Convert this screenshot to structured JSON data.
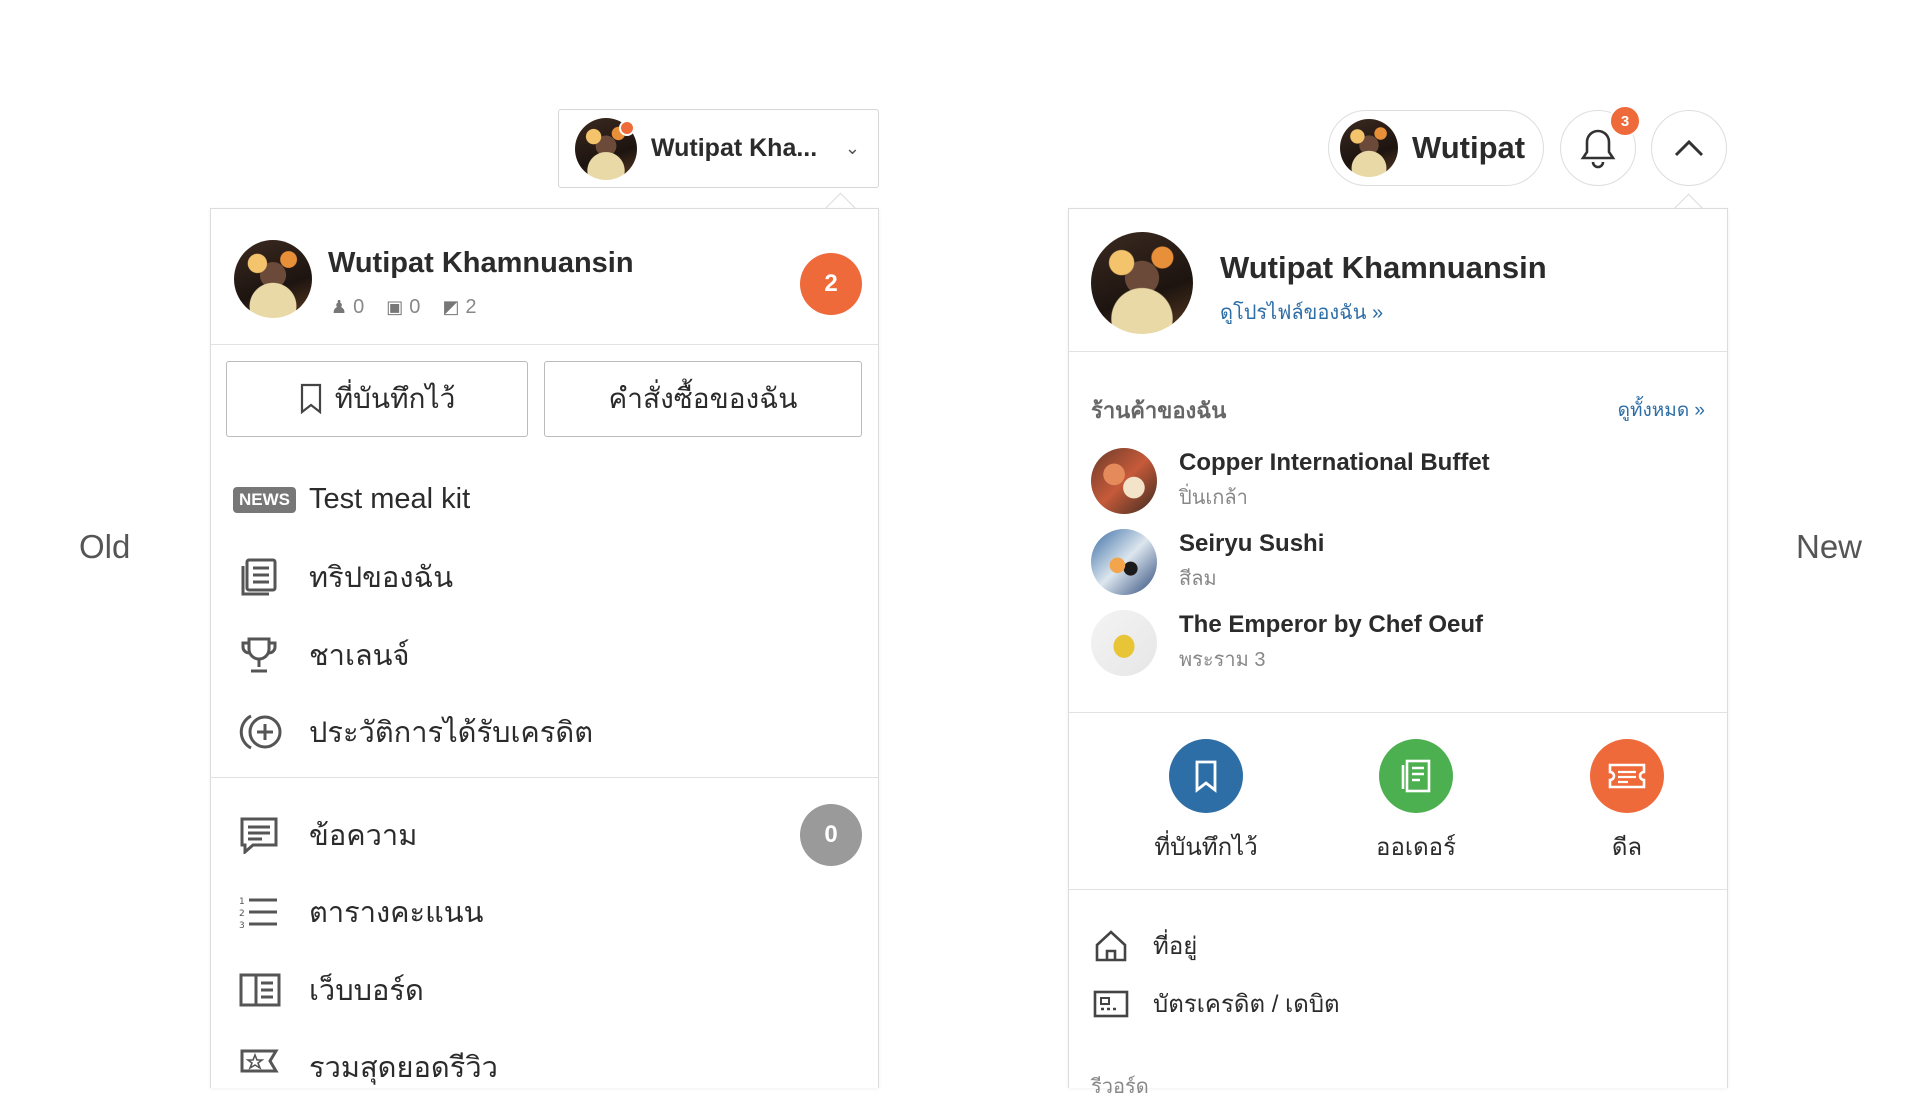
{
  "labels": {
    "old": "Old",
    "new": "New"
  },
  "old": {
    "trigger_name": "Wutipat Kha...",
    "user_name": "Wutipat Khamnuansin",
    "stats": {
      "followers": "0",
      "reviews": "0",
      "photos": "2"
    },
    "notif_count": "2",
    "btn_saved": "ที่บันทึกไว้",
    "btn_orders": "คำสั่งซื้อของฉัน",
    "news_tag": "NEWS",
    "items": [
      {
        "label": "Test meal kit"
      },
      {
        "label": "ทริปของฉัน"
      },
      {
        "label": "ชาเลนจ์"
      },
      {
        "label": "ประวัติการได้รับเครดิต"
      },
      {
        "label": "ข้อความ"
      },
      {
        "label": "ตารางคะแนน"
      },
      {
        "label": "เว็บบอร์ด"
      },
      {
        "label": "รวมสุดยอดรีวิว"
      }
    ],
    "message_count": "0"
  },
  "new": {
    "pill_name": "Wutipat",
    "notif_count": "3",
    "user_name": "Wutipat Khamnuansin",
    "profile_link": "ดูโปรไฟล์ของฉัน »",
    "shops_title": "ร้านค้าของฉัน",
    "shops_see_all": "ดูทั้งหมด »",
    "shops": [
      {
        "name": "Copper International Buffet",
        "location": "ปิ่นเกล้า"
      },
      {
        "name": "Seiryu Sushi",
        "location": "สีลม"
      },
      {
        "name": "The Emperor by Chef Oeuf",
        "location": "พระราม 3"
      }
    ],
    "actions": [
      {
        "label": "ที่บันทึกไว้",
        "color": "#2e6ea6"
      },
      {
        "label": "ออเดอร์",
        "color": "#4caf50"
      },
      {
        "label": "ดีล",
        "color": "#ef6a3a"
      }
    ],
    "links": [
      {
        "label": "ที่อยู่"
      },
      {
        "label": "บัตรเครดิต / เดบิต"
      }
    ],
    "rewards_label": "รีวอร์ด"
  }
}
